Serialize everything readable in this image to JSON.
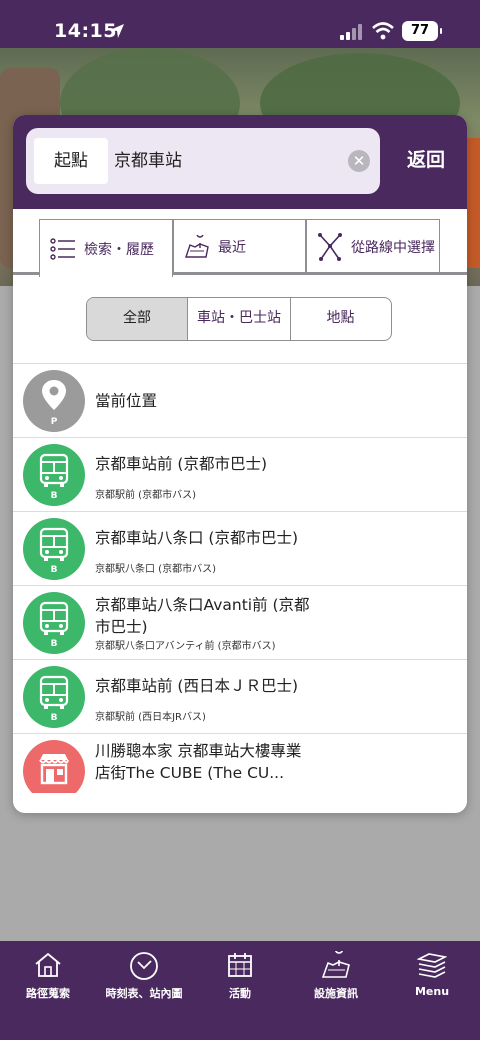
{
  "status_bar": {
    "time": "14:15",
    "battery": "77"
  },
  "search": {
    "origin_label": "起點",
    "value": "京都車站",
    "clear_symbol": "✕",
    "back_label": "返回"
  },
  "mode_tabs": [
    {
      "label": "檢索・履歷",
      "icon": "list-icon",
      "active": true
    },
    {
      "label": "最近",
      "icon": "map-icon",
      "active": false
    },
    {
      "label": "從路線中選擇",
      "icon": "route-icon",
      "active": false
    }
  ],
  "filters": [
    {
      "label": "全部",
      "active": true
    },
    {
      "label": "車站・巴士站",
      "active": false
    },
    {
      "label": "地點",
      "active": false
    }
  ],
  "results": [
    {
      "type": "location",
      "badge_letter": "P",
      "title": "當前位置",
      "subtitle": ""
    },
    {
      "type": "bus",
      "badge_letter": "B",
      "title": "京都車站前 (京都市巴士)",
      "subtitle": "京都駅前 (京都市バス)"
    },
    {
      "type": "bus",
      "badge_letter": "B",
      "title": "京都車站八条口 (京都市巴士)",
      "subtitle": "京都駅八条口 (京都市バス)"
    },
    {
      "type": "bus",
      "badge_letter": "B",
      "title": "京都車站八条口Avanti前 (京都市巴士)",
      "subtitle": "京都駅八条口アバンティ前 (京都市バス)"
    },
    {
      "type": "bus",
      "badge_letter": "B",
      "title": "京都車站前 (西日本ＪＲ巴士)",
      "subtitle": "京都駅前 (西日本JRバス)"
    },
    {
      "type": "shop",
      "badge_letter": "",
      "title": "川勝聰本家 京都車站大樓專業店街The CUBE (The CU...",
      "subtitle": ""
    }
  ],
  "bottom_nav": [
    {
      "label": "路徑蒐索",
      "icon": "home-icon"
    },
    {
      "label": "時刻表、站內圖",
      "icon": "clock-icon"
    },
    {
      "label": "活動",
      "icon": "calendar-icon"
    },
    {
      "label": "設施資訊",
      "icon": "map-facility-icon"
    },
    {
      "label": "Menu",
      "icon": "layers-icon"
    }
  ],
  "colors": {
    "brand_purple": "#4a2a5e",
    "bus_green": "#3db86a",
    "shop_red": "#ee6a6a",
    "location_gray": "#9b9b9b"
  }
}
